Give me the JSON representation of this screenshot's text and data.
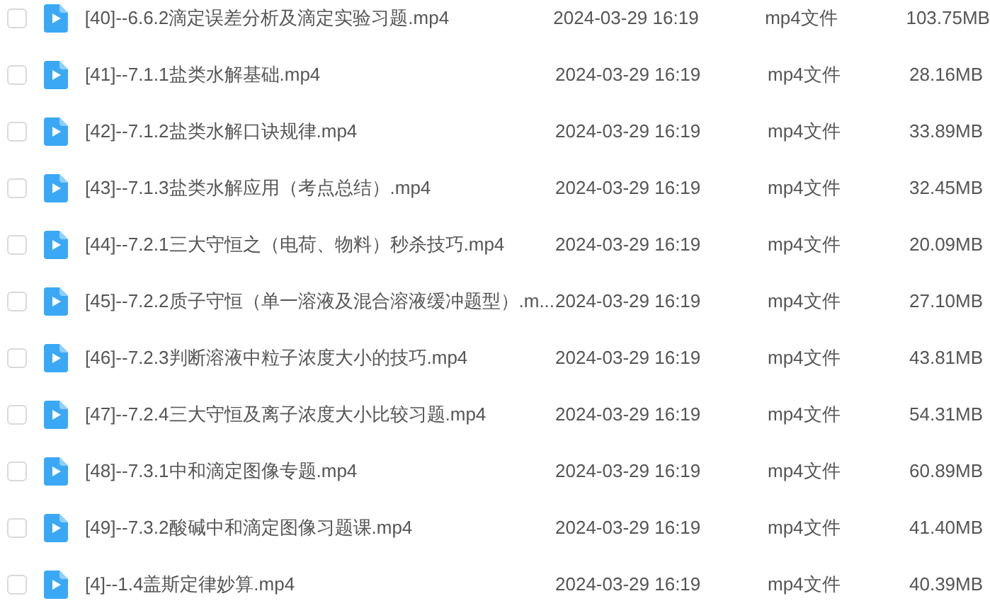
{
  "files": [
    {
      "name": "[40]--6.6.2滴定误差分析及滴定实验习题.mp4",
      "date": "2024-03-29 16:19",
      "type": "mp4文件",
      "size": "103.75MB",
      "selected": false
    },
    {
      "name": "[41]--7.1.1盐类水解基础.mp4",
      "date": "2024-03-29 16:19",
      "type": "mp4文件",
      "size": "28.16MB",
      "selected": false
    },
    {
      "name": "[42]--7.1.2盐类水解口诀规律.mp4",
      "date": "2024-03-29 16:19",
      "type": "mp4文件",
      "size": "33.89MB",
      "selected": false
    },
    {
      "name": "[43]--7.1.3盐类水解应用（考点总结）.mp4",
      "date": "2024-03-29 16:19",
      "type": "mp4文件",
      "size": "32.45MB",
      "selected": false
    },
    {
      "name": "[44]--7.2.1三大守恒之（电荷、物料）秒杀技巧.mp4",
      "date": "2024-03-29 16:19",
      "type": "mp4文件",
      "size": "20.09MB",
      "selected": false
    },
    {
      "name": "[45]--7.2.2质子守恒（单一溶液及混合溶液缓冲题型）.m...",
      "date": "2024-03-29 16:19",
      "type": "mp4文件",
      "size": "27.10MB",
      "selected": false
    },
    {
      "name": "[46]--7.2.3判断溶液中粒子浓度大小的技巧.mp4",
      "date": "2024-03-29 16:19",
      "type": "mp4文件",
      "size": "43.81MB",
      "selected": false
    },
    {
      "name": "[47]--7.2.4三大守恒及离子浓度大小比较习题.mp4",
      "date": "2024-03-29 16:19",
      "type": "mp4文件",
      "size": "54.31MB",
      "selected": false
    },
    {
      "name": "[48]--7.3.1中和滴定图像专题.mp4",
      "date": "2024-03-29 16:19",
      "type": "mp4文件",
      "size": "60.89MB",
      "selected": false
    },
    {
      "name": "[49]--7.3.2酸碱中和滴定图像习题课.mp4",
      "date": "2024-03-29 16:19",
      "type": "mp4文件",
      "size": "41.40MB",
      "selected": false
    },
    {
      "name": "[4]--1.4盖斯定律妙算.mp4",
      "date": "2024-03-29 16:19",
      "type": "mp4文件",
      "size": "40.39MB",
      "selected": false
    }
  ]
}
